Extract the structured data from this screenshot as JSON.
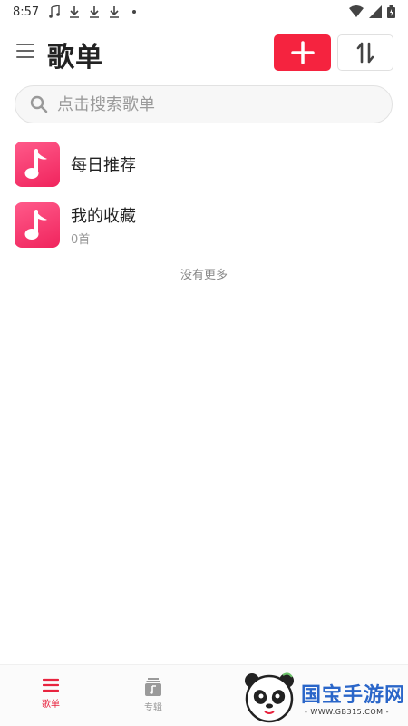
{
  "status_bar": {
    "time": "8:57"
  },
  "header": {
    "title": "歌单",
    "add_label": "+",
    "sort_label": "sort"
  },
  "search": {
    "placeholder": "点击搜索歌单",
    "value": ""
  },
  "playlists": [
    {
      "name": "每日推荐",
      "count": ""
    },
    {
      "name": "我的收藏",
      "count": "0首"
    }
  ],
  "list_footer": "没有更多",
  "bottom_nav": {
    "items": [
      {
        "label": "歌单",
        "icon": "menu-list-icon",
        "active": true
      },
      {
        "label": "专辑",
        "icon": "album-icon",
        "active": false
      }
    ]
  },
  "watermark": {
    "title": "国宝手游网",
    "url": "- WWW.GB315.COM -"
  },
  "colors": {
    "accent": "#f5233f",
    "cover_gradient_start": "#ff5a8a",
    "cover_gradient_end": "#f0245d",
    "nav_active": "#e8243f"
  }
}
